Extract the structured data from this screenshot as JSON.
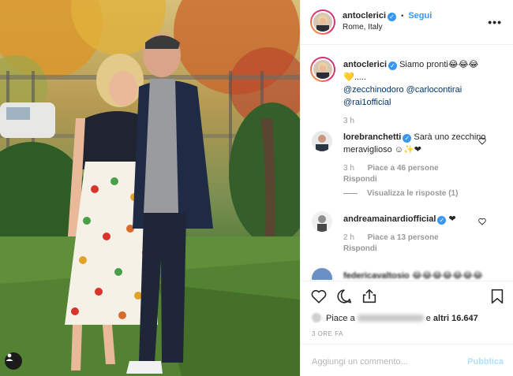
{
  "header": {
    "username": "antoclerici",
    "follow_label": "Segui",
    "separator": "•",
    "location": "Rome, Italy",
    "more_label": "•••"
  },
  "caption": {
    "username": "antoclerici",
    "text": "Siamo pronti😂😂😂 💛.....",
    "mentions": [
      "@zecchinodoro",
      "@carlocontirai",
      "@rai1official"
    ],
    "time": "3 h"
  },
  "comments": [
    {
      "username": "lorebranchetti",
      "text": "Sarà uno zecchino meraviglioso ☺✨❤",
      "time": "3 h",
      "likes": "Piace a 46 persone",
      "reply": "Rispondi",
      "thread_label": "Visualizza le risposte (1)"
    },
    {
      "username": "andreamainardiofficial",
      "text": "❤",
      "time": "2 h",
      "likes": "Piace a 13 persone",
      "reply": "Rispondi"
    },
    {
      "username": "federicavaltosio",
      "text": "😂😂😂😂😂😂😂"
    }
  ],
  "likes": {
    "prefix": "Piace a",
    "middle": "e",
    "others": "altri 16.647"
  },
  "timeago": "3 ORE FA",
  "add_comment": {
    "placeholder": "Aggiungi un commento...",
    "publish_label": "Pubblica"
  },
  "colors": {
    "accent": "#3897f0",
    "mention": "#003569",
    "muted": "#999999",
    "publish_disabled": "#b2dffc"
  },
  "icons": {
    "photo_tag": "person-tag-icon",
    "like": "heart-icon",
    "comment": "comment-bubble-icon",
    "share": "share-icon",
    "save": "bookmark-icon",
    "more": "more-options-icon"
  }
}
